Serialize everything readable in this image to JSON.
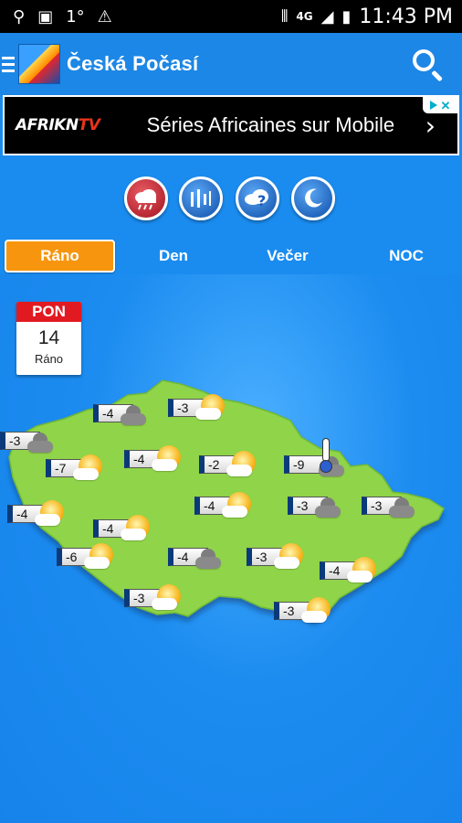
{
  "status_bar": {
    "left_icons": [
      "usb-icon",
      "image-icon",
      "temperature-icon",
      "warning-icon"
    ],
    "temperature": "1°",
    "right_icons": [
      "vibrate-icon",
      "network-4g-icon",
      "signal-icon",
      "battery-icon"
    ],
    "network": "4G",
    "time": "11:43 PM"
  },
  "app_bar": {
    "title": "Česká Počasí"
  },
  "ad": {
    "brand": "AFRIKN",
    "brand_tv": "TV",
    "text": "Séries Africaines sur Mobile",
    "arrow": "›"
  },
  "tabs": [
    {
      "label": "Ráno",
      "active": true
    },
    {
      "label": "Den",
      "active": false
    },
    {
      "label": "Večer",
      "active": false
    },
    {
      "label": "NOC",
      "active": false
    }
  ],
  "calendar": {
    "weekday": "PON",
    "day": "14",
    "part": "Ráno"
  },
  "markers": [
    {
      "temp": "-4",
      "icon": "cloudy-dark"
    },
    {
      "temp": "-3",
      "icon": "sun-cloud"
    },
    {
      "temp": "-3",
      "icon": "cloudy-dark"
    },
    {
      "temp": "-7",
      "icon": "sun-cloud"
    },
    {
      "temp": "-4",
      "icon": "sun-cloud"
    },
    {
      "temp": "-2",
      "icon": "sun-cloud"
    },
    {
      "temp": "-9",
      "icon": "thermometer-cloudy"
    },
    {
      "temp": "-4",
      "icon": "sun-cloud"
    },
    {
      "temp": "-4",
      "icon": "sun-cloud"
    },
    {
      "temp": "-3",
      "icon": "cloudy-dark"
    },
    {
      "temp": "-3",
      "icon": "cloudy-dark"
    },
    {
      "temp": "-4",
      "icon": "sun-cloud"
    },
    {
      "temp": "-6",
      "icon": "sun-cloud"
    },
    {
      "temp": "-4",
      "icon": "cloudy-dark"
    },
    {
      "temp": "-3",
      "icon": "sun-cloud"
    },
    {
      "temp": "-4",
      "icon": "sun-cloud"
    },
    {
      "temp": "-3",
      "icon": "sun-cloud"
    },
    {
      "temp": "-3",
      "icon": "sun-cloud"
    }
  ],
  "colors": {
    "background": "#1a8cf0",
    "map_green": "#8fd44a",
    "active_tab": "#f7960e",
    "calendar_red": "#e11a22"
  }
}
